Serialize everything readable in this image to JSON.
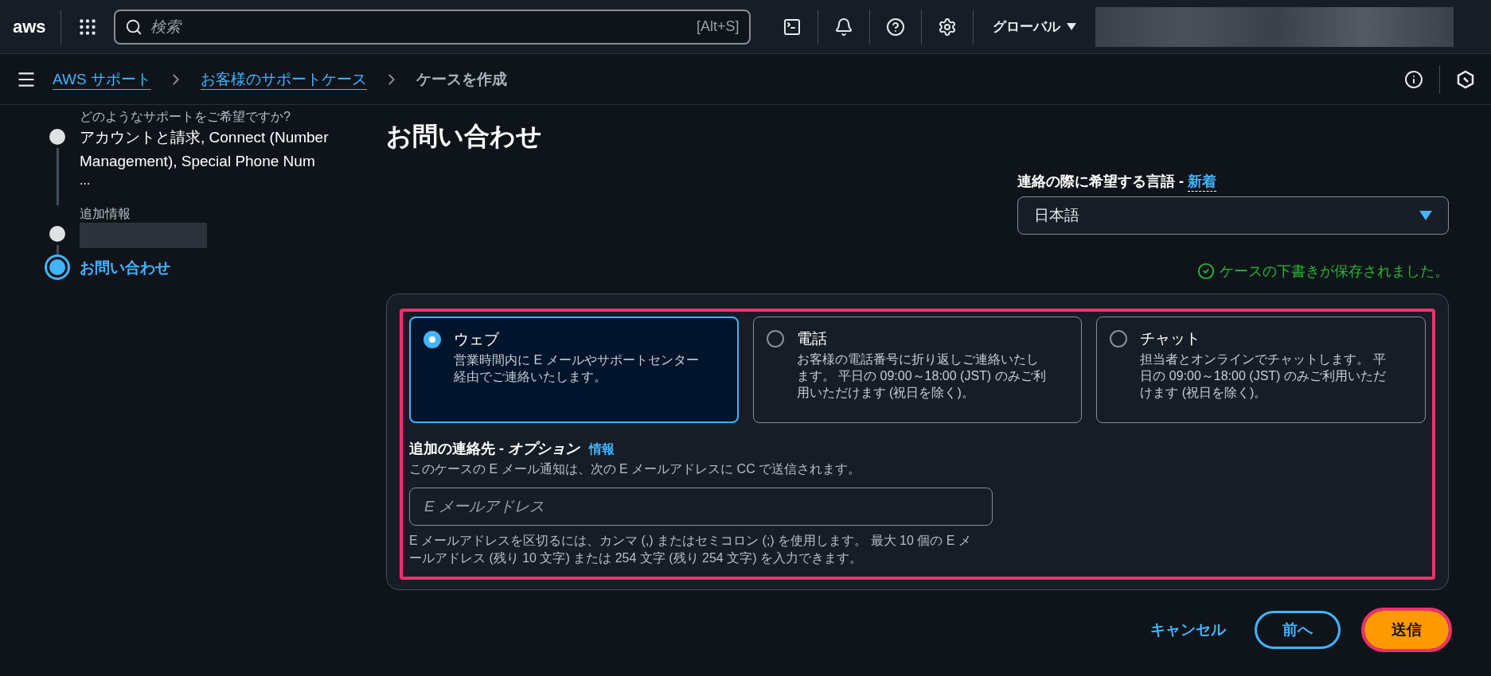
{
  "top_bar": {
    "logo": "aws",
    "search": {
      "placeholder": "検索",
      "shortcut": "[Alt+S]"
    },
    "region": "グローバル"
  },
  "breadcrumbs": [
    {
      "label": "AWS サポート",
      "kind": "link"
    },
    {
      "label": "お客様のサポートケース",
      "kind": "link"
    },
    {
      "label": "ケースを作成",
      "kind": "current"
    }
  ],
  "steps": [
    {
      "label": "どのようなサポートをご希望ですか?",
      "value": "アカウントと請求, Connect (Number Management), Special Phone Num",
      "more": "...",
      "current": false
    },
    {
      "label": "追加情報",
      "current": false
    },
    {
      "label": "お問い合わせ",
      "current": true
    }
  ],
  "page_title": "お問い合わせ",
  "language": {
    "label": "連絡の際に希望する言語 - ",
    "badge": "新着",
    "value": "日本語"
  },
  "saved_message": "ケースの下書きが保存されました。",
  "contact_methods": [
    {
      "title": "ウェブ",
      "description": "営業時間内に E メールやサポートセンター経由でご連絡いたします。",
      "selected": true
    },
    {
      "title": "電話",
      "description": "お客様の電話番号に折り返しご連絡いたします。 平日の 09:00～18:00 (JST) のみご利用いただけます (祝日を除く)。",
      "selected": false
    },
    {
      "title": "チャット",
      "description": "担当者とオンラインでチャットします。 平日の 09:00～18:00 (JST) のみご利用いただけます (祝日を除く)。",
      "selected": false
    }
  ],
  "additional_contact": {
    "title": "追加の連絡先 - ",
    "optional": "オプション",
    "info_link": "情報",
    "description": "このケースの E メール通知は、次の E メールアドレスに CC で送信されます。",
    "placeholder": "E メールアドレス",
    "hint": "E メールアドレスを区切るには、カンマ (,) またはセミコロン (;) を使用します。 最大 10 個の E メールアドレス (残り 10 文字) または 254 文字 (残り 254 文字) を入力できます。",
    "highlighted": true
  },
  "buttons": [
    {
      "label": "キャンセル",
      "kind": "link",
      "highlighted": false
    },
    {
      "label": "前へ",
      "kind": "secondary",
      "highlighted": false
    },
    {
      "label": "送信",
      "kind": "primary",
      "highlighted": true
    }
  ]
}
